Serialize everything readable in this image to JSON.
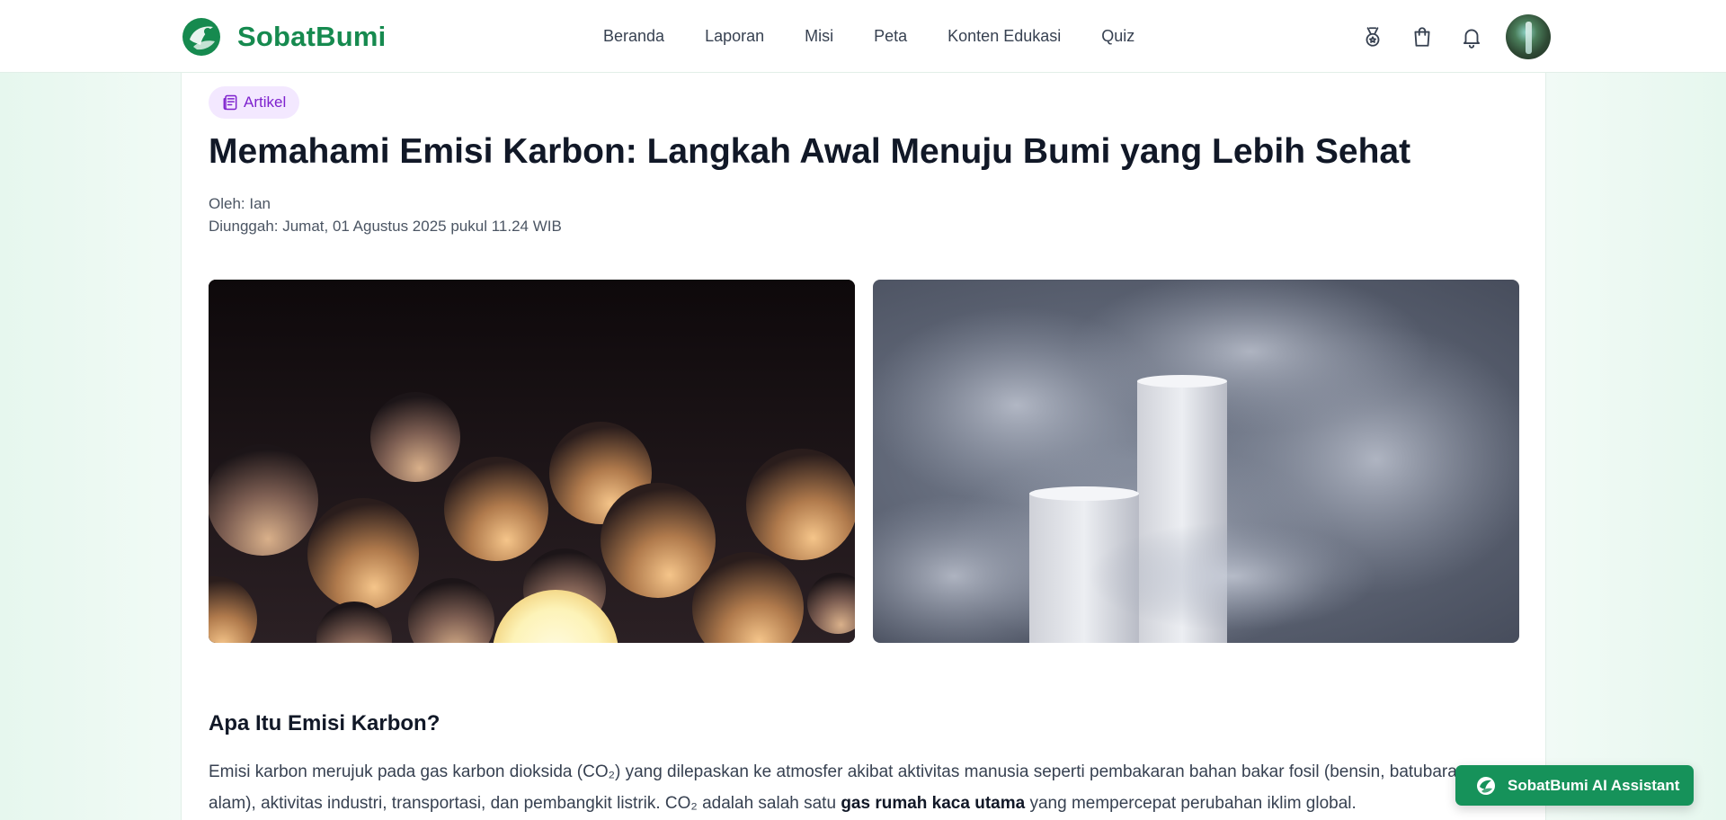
{
  "brand": {
    "name": "SobatBumi",
    "logo_icon": "earth-leaf-icon",
    "color": "#168a4f"
  },
  "nav": {
    "items": [
      {
        "label": "Beranda"
      },
      {
        "label": "Laporan"
      },
      {
        "label": "Misi"
      },
      {
        "label": "Peta"
      },
      {
        "label": "Konten Edukasi"
      },
      {
        "label": "Quiz"
      }
    ]
  },
  "header_actions": {
    "icons": [
      "medal-icon",
      "shopping-bag-icon",
      "bell-icon"
    ],
    "avatar": "user-avatar"
  },
  "article": {
    "category": "Artikel",
    "category_icon": "newspaper-icon",
    "title": "Memahami Emisi Karbon: Langkah Awal Menuju Bumi yang Lebih Sehat",
    "author": "Oleh: Ian",
    "uploaded": "Diunggah: Jumat, 01 Agustus 2025 pukul 11.24 WIB",
    "images": [
      "glowing-spheres-photo",
      "smokestacks-smoke-photo"
    ],
    "section_heading": "Apa Itu Emisi Karbon?",
    "paragraph_part1": "Emisi karbon merujuk pada gas karbon dioksida (CO₂) yang dilepaskan ke atmosfer akibat aktivitas manusia seperti pembakaran bahan bakar fosil (bensin, batubara, gas alam), aktivitas industri, transportasi, dan pembangkit listrik. CO₂ adalah salah satu ",
    "paragraph_bold": "gas rumah kaca utama",
    "paragraph_part2": " yang mempercepat perubahan iklim global."
  },
  "assistant": {
    "label": "SobatBumi AI Assistant",
    "color": "#16925a"
  }
}
